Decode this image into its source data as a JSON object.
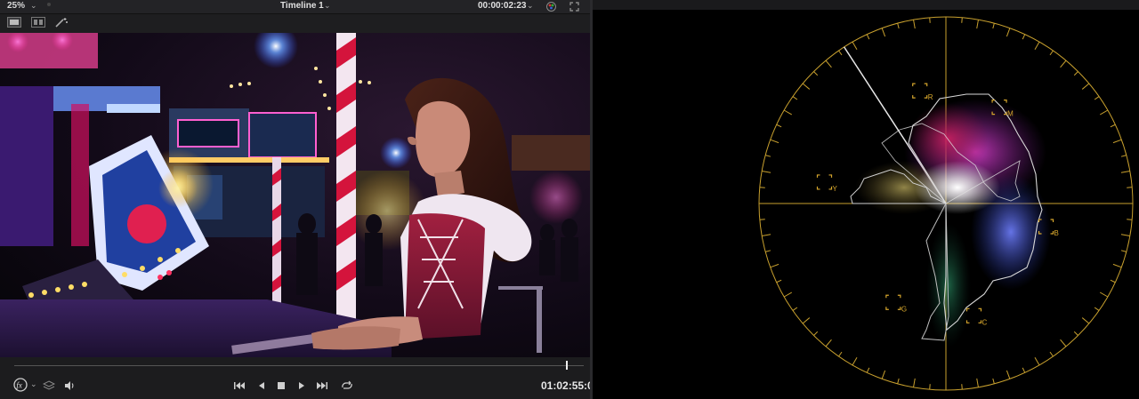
{
  "viewer": {
    "zoom_label": "25%",
    "timeline_name": "Timeline 1",
    "source_timecode": "00:00:02:23",
    "record_timecode": "01:02:55:0",
    "playhead_fraction": 0.97
  },
  "toolbar": {
    "icons": [
      "single-viewer-icon",
      "dual-viewer-icon",
      "magic-wand-icon"
    ]
  },
  "transport": {
    "left_icons": [
      "fx-icon",
      "layers-icon",
      "speaker-icon"
    ],
    "controls": [
      "jump-to-start-icon",
      "play-reverse-icon",
      "stop-icon",
      "play-icon",
      "jump-to-end-icon",
      "loop-icon"
    ]
  },
  "vectorscope": {
    "targets": [
      {
        "label": "R"
      },
      {
        "label": "M"
      },
      {
        "label": "B"
      },
      {
        "label": "C"
      },
      {
        "label": "G"
      },
      {
        "label": "Y"
      }
    ],
    "graticule_color": "#c8a02e",
    "target_color": "#d6a62c",
    "skin_tone_line": true
  }
}
